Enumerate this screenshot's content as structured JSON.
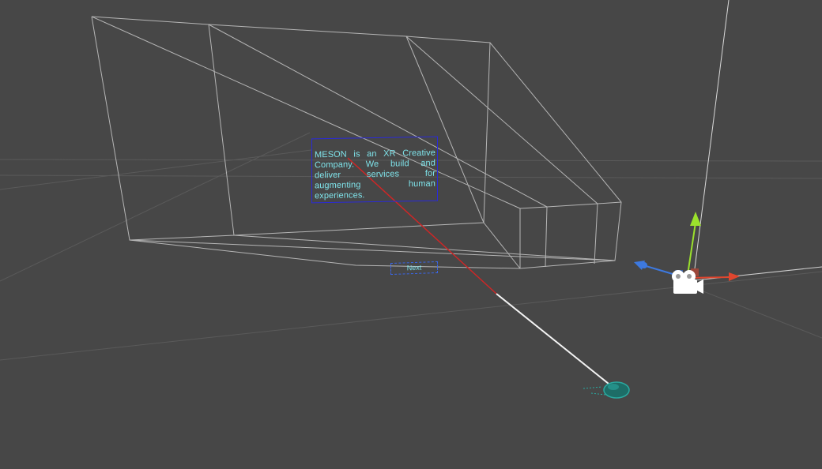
{
  "scene": {
    "text_panel": {
      "body": "MESON is an XR Creative Company. We build and deliver services for augmenting human experiences."
    },
    "next_button": {
      "label": "Next"
    },
    "gizmo": {
      "x_axis_color": "#e0462e",
      "y_axis_color": "#9be12c",
      "z_axis_color": "#3d79e0"
    },
    "colors": {
      "background": "#474747",
      "wireframe": "#c9c9c9",
      "pointer_ray": "#d02626",
      "reticle": "#2aa9a0"
    }
  }
}
